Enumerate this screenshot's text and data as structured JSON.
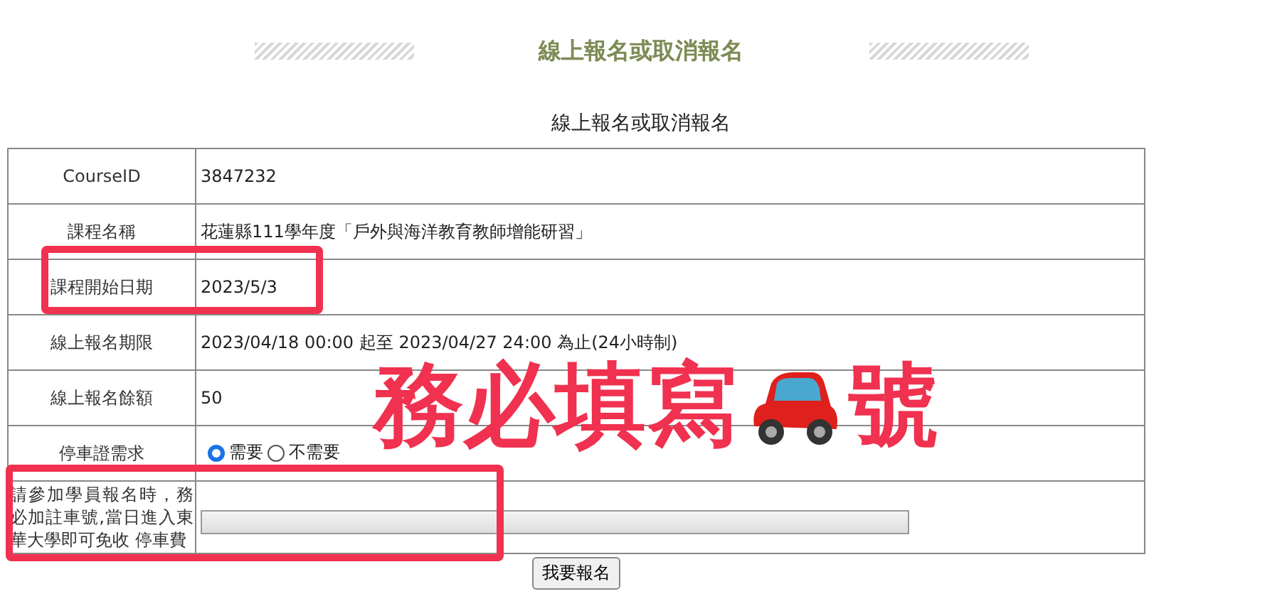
{
  "header": {
    "title": "線上報名或取消報名"
  },
  "form": {
    "title": "線上報名或取消報名",
    "rows": [
      {
        "kind": "text",
        "label": "CourseID",
        "value": "3847232",
        "highlighted": false
      },
      {
        "kind": "text",
        "label": "課程名稱",
        "value": "花蓮縣111學年度「戶外與海洋教育教師增能研習」",
        "highlighted": false
      },
      {
        "kind": "text",
        "label": "課程開始日期",
        "value": "2023/5/3",
        "highlighted": true
      },
      {
        "kind": "text",
        "label": "線上報名期限",
        "value": "2023/04/18 00:00  起至 2023/04/27 24:00 為止(24小時制)",
        "highlighted": false
      },
      {
        "kind": "text",
        "label": "線上報名餘額",
        "value": "50",
        "highlighted": false
      },
      {
        "kind": "radio",
        "label": "停車證需求",
        "options": [
          {
            "label": "需要",
            "selected": true
          },
          {
            "label": "不需要",
            "selected": false
          }
        ],
        "highlighted": false
      },
      {
        "kind": "input",
        "label": "請參加學員報名時，務必加註車號,當日進入東華大學即可免收 停車費",
        "highlighted": true
      }
    ],
    "submit": "我要報名"
  },
  "annotation": {
    "text_before": "務必填寫",
    "text_after": "號"
  }
}
